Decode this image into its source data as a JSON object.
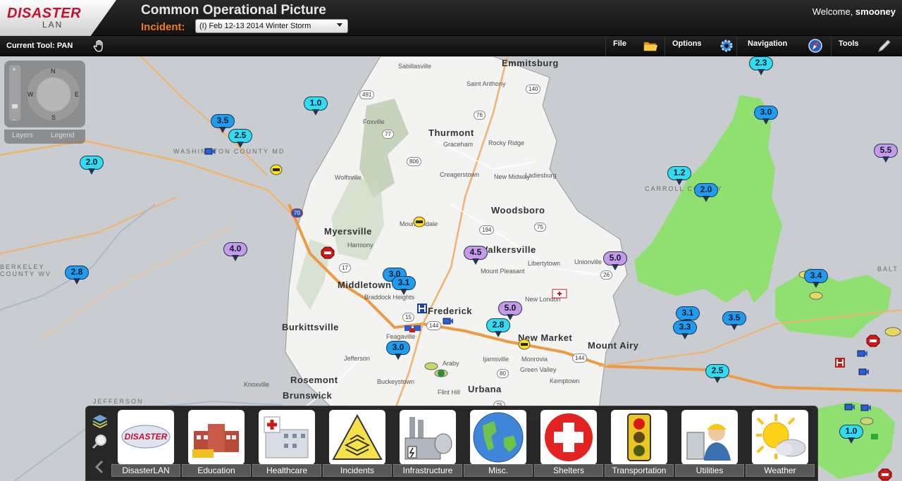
{
  "header": {
    "logo_top": "DISASTER",
    "logo_bottom": "LAN",
    "title": "Common Operational Picture",
    "incident_label": "Incident:",
    "incident_value": "(I) Feb 12-13 2014 Winter Storm",
    "welcome_prefix": "Welcome,",
    "username": "smooney"
  },
  "toolbar": {
    "current_tool": "Current Tool: PAN",
    "file": "File",
    "options": "Options",
    "navigation": "Navigation",
    "tools": "Tools"
  },
  "nav_control": {
    "zoom_in": "+",
    "zoom_out": "-",
    "compass_n": "N",
    "compass_s": "S",
    "compass_e": "E",
    "compass_w": "W",
    "layers": "Layers",
    "legend": "Legend"
  },
  "map": {
    "places": [
      "Emmitsburg",
      "Sabillasville",
      "Saint Anthony",
      "Foxville",
      "Thurmont",
      "Graceham",
      "Rocky Ridge",
      "Creagerstown",
      "New Midway",
      "Ladiesburg",
      "Wolfsville",
      "Woodsboro",
      "Mountaindale",
      "Myersville",
      "Harmony",
      "Walkersville",
      "Libertytown",
      "Unionville",
      "Mount Pleasant",
      "Middletown",
      "Braddock Heights",
      "Frederick",
      "New London",
      "Burkittsville",
      "New Market",
      "Mount Airy",
      "Feagaville",
      "Jefferson",
      "Ijamsville",
      "Monrovia",
      "Green Valley",
      "Kemptown",
      "Rosemont",
      "Araby",
      "Buckeystown",
      "Knoxville",
      "Brunswick",
      "Flint Hill",
      "Urbana",
      "WASHINGTON COUNTY MD",
      "CARROLL COUNTY",
      "BERKELEY COUNTY WV",
      "JEFFERSON",
      "BALT"
    ],
    "shields": [
      "491",
      "140",
      "76",
      "77",
      "806",
      "194",
      "75",
      "26",
      "17",
      "70",
      "144",
      "15",
      "80",
      "144",
      "75"
    ],
    "pins": [
      "2.3",
      "1.0",
      "3.0",
      "3.5",
      "2.5",
      "2.0",
      "1.2",
      "2.0",
      "5.5",
      "4.0",
      "4.5",
      "5.0",
      "2.8",
      "3.0",
      "3.1",
      "5.0",
      "2.8",
      "3.4",
      "3.0",
      "3.1",
      "3.3",
      "3.5",
      "2.5",
      "1.0"
    ]
  },
  "categories": [
    {
      "label": "DisasterLAN"
    },
    {
      "label": "Education"
    },
    {
      "label": "Healthcare"
    },
    {
      "label": "Incidents"
    },
    {
      "label": "Infrastructure"
    },
    {
      "label": "Misc."
    },
    {
      "label": "Shelters"
    },
    {
      "label": "Transportation"
    },
    {
      "label": "Utilities"
    },
    {
      "label": "Weather"
    }
  ],
  "colors": {
    "accent_orange": "#f07d1d",
    "brand_red": "#c8102e",
    "county_green": "#8fe070",
    "pin_cyan": "#2fdcf0",
    "pin_blue": "#1e9cf0",
    "pin_purple": "#c69ae8"
  }
}
